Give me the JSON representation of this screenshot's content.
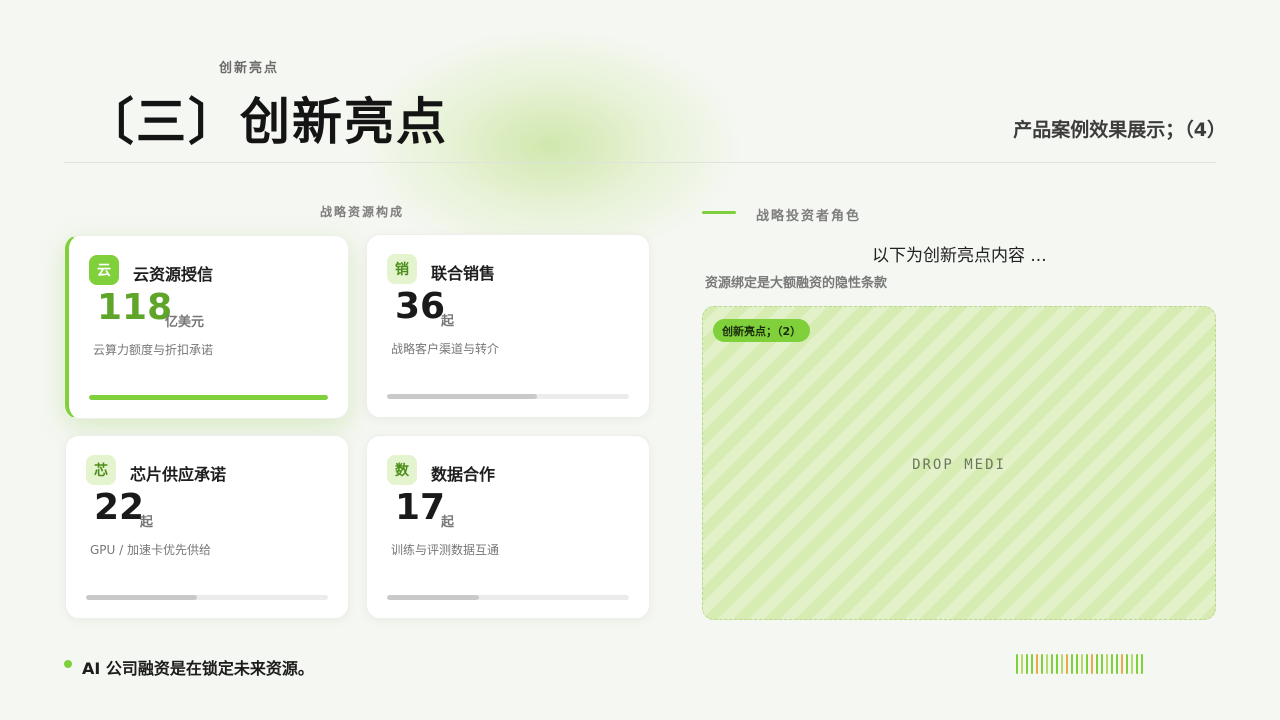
{
  "header": {
    "kicker": "创新亮点",
    "title": "〔三〕创新亮点",
    "right_title": "产品案例效果展示；（4）"
  },
  "left_section": {
    "caption": "战略资源构成",
    "cards": [
      {
        "badge": "云",
        "title": "云资源授信",
        "value": "118",
        "unit": "亿美元",
        "desc": "云算力额度与折扣承诺",
        "progress": 1.0,
        "active": true
      },
      {
        "badge": "销",
        "title": "联合销售",
        "value": "36",
        "unit": "起",
        "desc": "战略客户渠道与转介",
        "progress": 0.62,
        "active": false
      },
      {
        "badge": "芯",
        "title": "芯片供应承诺",
        "value": "22",
        "unit": "起",
        "desc": "GPU /  加速卡优先供给",
        "progress": 0.46,
        "active": false
      },
      {
        "badge": "数",
        "title": "数据合作",
        "value": "17",
        "unit": "起",
        "desc": "训练与评测数据互通",
        "progress": 0.38,
        "active": false
      }
    ]
  },
  "right_section": {
    "caption": "战略投资者角色",
    "intro": "以下为创新亮点内容 ...",
    "clause": "资源绑定是大额融资的隐性条款",
    "drop_tag": "创新亮点；（2）",
    "drop_text": "DROP MEDI"
  },
  "footer": {
    "text": "AI  公司融资是在锁定未来资源。"
  },
  "colors": {
    "accent": "#7fd03b",
    "accent_dark": "#5fa52a",
    "barcode": [
      "#7fd03b",
      "#b6d96a",
      "#e9a84a"
    ]
  }
}
